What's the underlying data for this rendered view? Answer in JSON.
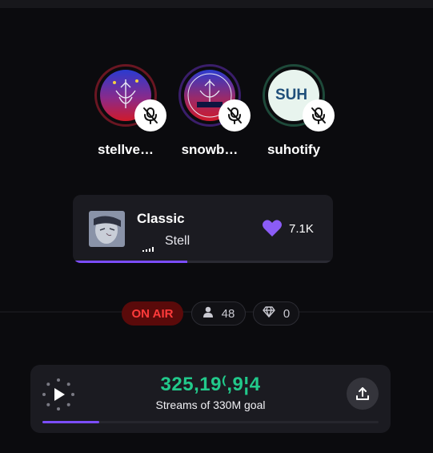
{
  "speakers": [
    {
      "name": "stellve…",
      "ring_color": "#6a1622",
      "icon": "mic-off-icon"
    },
    {
      "name": "snowb…",
      "ring_color": "#3a1e6a",
      "icon": "mic-off-icon"
    },
    {
      "name": "suhotify",
      "ring_color": "#1e4a3a",
      "logo_text": "SUH",
      "icon": "mic-off-icon"
    }
  ],
  "now_playing": {
    "title": "Classic",
    "artist": "Stell",
    "likes": "7.1K",
    "progress": 0.44,
    "accent": "#7c4dff"
  },
  "status": {
    "on_air_label": "ON AIR",
    "listeners": "48",
    "gems": "0",
    "on_air_color": "#ff3b3b"
  },
  "streams": {
    "count": "325,19⁽,9¦4",
    "label": "Streams of 330M goal",
    "progress": 0.17,
    "count_color": "#22c98b"
  }
}
